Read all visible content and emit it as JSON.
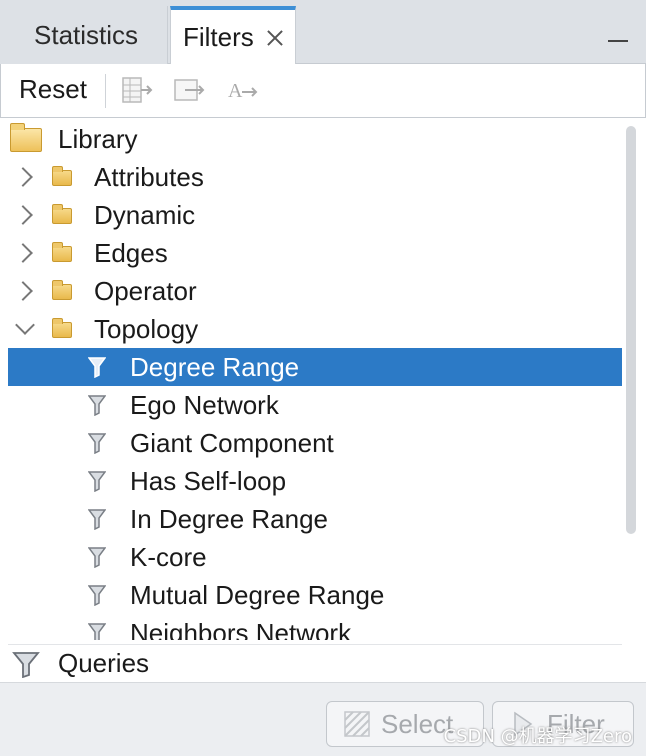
{
  "tabs": {
    "statistics_label": "Statistics",
    "filters_label": "Filters"
  },
  "toolbar": {
    "reset_label": "Reset",
    "icons": [
      "export-table-icon",
      "export-arrow-icon",
      "text-settings-icon"
    ]
  },
  "tree": {
    "root_label": "Library",
    "categories": [
      {
        "label": "Attributes",
        "expanded": false
      },
      {
        "label": "Dynamic",
        "expanded": false
      },
      {
        "label": "Edges",
        "expanded": false
      },
      {
        "label": "Operator",
        "expanded": false
      },
      {
        "label": "Topology",
        "expanded": true
      }
    ],
    "topology_items": [
      {
        "label": "Degree Range",
        "selected": true
      },
      {
        "label": "Ego Network"
      },
      {
        "label": "Giant Component"
      },
      {
        "label": "Has Self-loop"
      },
      {
        "label": "In Degree Range"
      },
      {
        "label": "K-core"
      },
      {
        "label": "Mutual Degree Range"
      },
      {
        "label": "Neighbors Network"
      }
    ]
  },
  "queries": {
    "label": "Queries"
  },
  "buttons": {
    "select_label": "Select",
    "filter_label": "Filter"
  },
  "watermark": "CSDN @机器学习Zero",
  "colors": {
    "selection": "#2c7ac6",
    "tab_accent": "#3d8fd6"
  }
}
